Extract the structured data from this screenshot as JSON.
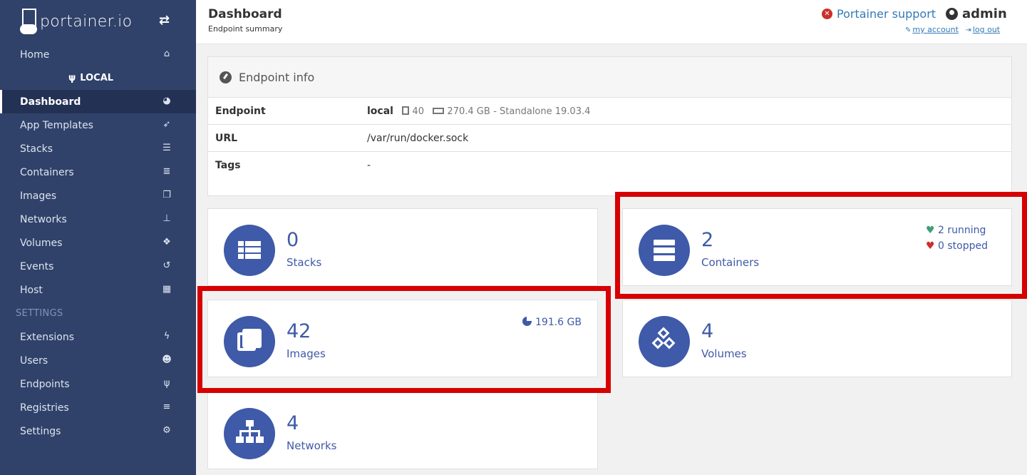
{
  "brand": {
    "name": "portainer.io"
  },
  "sidebar": {
    "home": "Home",
    "endpoint": "LOCAL",
    "items": [
      {
        "label": "Dashboard",
        "icon": "gauge-icon"
      },
      {
        "label": "App Templates",
        "icon": "rocket-icon"
      },
      {
        "label": "Stacks",
        "icon": "list-icon"
      },
      {
        "label": "Containers",
        "icon": "server-icon"
      },
      {
        "label": "Images",
        "icon": "clone-icon"
      },
      {
        "label": "Networks",
        "icon": "sitemap-icon"
      },
      {
        "label": "Volumes",
        "icon": "cubes-icon"
      },
      {
        "label": "Events",
        "icon": "history-icon"
      },
      {
        "label": "Host",
        "icon": "grid-icon"
      }
    ],
    "settings_section": "SETTINGS",
    "settings_items": [
      {
        "label": "Extensions",
        "icon": "bolt-icon"
      },
      {
        "label": "Users",
        "icon": "users-icon"
      },
      {
        "label": "Endpoints",
        "icon": "plug-icon"
      },
      {
        "label": "Registries",
        "icon": "database-icon"
      },
      {
        "label": "Settings",
        "icon": "cogs-icon"
      }
    ]
  },
  "header": {
    "title": "Dashboard",
    "subtitle": "Endpoint summary",
    "support": "Portainer support",
    "user": "admin",
    "my_account": "my account",
    "log_out": "log out"
  },
  "endpoint_info": {
    "heading": "Endpoint info",
    "rows": {
      "endpoint": {
        "key": "Endpoint",
        "name": "local",
        "cpu": "40",
        "memory": "270.4 GB",
        "type": "- Standalone 19.03.4"
      },
      "url": {
        "key": "URL",
        "value": "/var/run/docker.sock"
      },
      "tags": {
        "key": "Tags",
        "value": "-"
      }
    }
  },
  "tiles": {
    "stacks": {
      "count": "0",
      "label": "Stacks"
    },
    "containers": {
      "count": "2",
      "label": "Containers",
      "running": "2 running",
      "stopped": "0 stopped"
    },
    "images": {
      "count": "42",
      "label": "Images",
      "size": "191.6 GB"
    },
    "volumes": {
      "count": "4",
      "label": "Volumes"
    },
    "networks": {
      "count": "4",
      "label": "Networks"
    }
  },
  "colors": {
    "sidebar": "#30426a",
    "accent": "#3e5aa8",
    "highlight": "#d60000"
  }
}
